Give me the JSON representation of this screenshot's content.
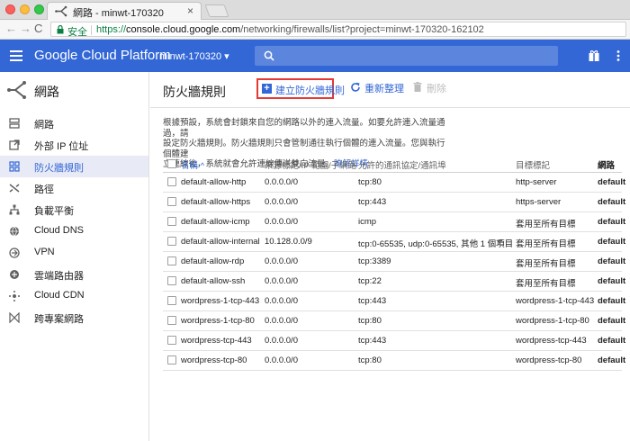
{
  "browser": {
    "tab_title": "網路 - minwt-170320",
    "tab_close": "×",
    "secure_label": "安全",
    "url_scheme": "https://",
    "url_host": "console.cloud.google.com",
    "url_path": "/networking/firewalls/list?project=minwt-170320-162102",
    "nav_back": "←",
    "nav_forward": "→",
    "nav_reload": "C"
  },
  "header": {
    "brand": "Google Cloud Platform",
    "project": "minwt-170320 ▾",
    "accent_color": "#3367d6"
  },
  "sidebar": {
    "title": "網路",
    "items": [
      {
        "label": "網路",
        "icon": "network-icon",
        "active": false
      },
      {
        "label": "外部 IP 位址",
        "icon": "external-ip-icon",
        "active": false
      },
      {
        "label": "防火牆規則",
        "icon": "firewall-icon",
        "active": true
      },
      {
        "label": "路徑",
        "icon": "routes-icon",
        "active": false
      },
      {
        "label": "負載平衡",
        "icon": "load-balancing-icon",
        "active": false
      },
      {
        "label": "Cloud DNS",
        "icon": "dns-icon",
        "active": false
      },
      {
        "label": "VPN",
        "icon": "vpn-icon",
        "active": false
      },
      {
        "label": "雲端路由器",
        "icon": "router-icon",
        "active": false
      },
      {
        "label": "Cloud CDN",
        "icon": "cdn-icon",
        "active": false
      },
      {
        "label": "跨專案網路",
        "icon": "xpn-icon",
        "active": false
      }
    ]
  },
  "page": {
    "title": "防火牆規則",
    "create_label": "建立防火牆規則",
    "refresh_label": "重新整理",
    "delete_label": "刪除",
    "description_1": "根據預設，系統會封鎖來自您的網路以外的連入流量。如要允許連入流量通過，請",
    "description_2": "設定防火牆規則。防火牆規則只會管制通往執行個體的連入流量。您與執行個體建",
    "description_3": "立連線後，系統就會允許連線傳送雙向流量。",
    "learn_more": "瞭解詳情"
  },
  "table": {
    "headers": {
      "name": "名稱 ^",
      "source": "來源標記/IP 範圍/子網路",
      "protocol": "允許的通訊協定/通訊埠",
      "target": "目標標記",
      "network": "網路"
    },
    "rows": [
      {
        "name": "default-allow-http",
        "source": "0.0.0.0/0",
        "protocol": "tcp:80",
        "target": "http-server",
        "network": "default",
        "dropdown": ""
      },
      {
        "name": "default-allow-https",
        "source": "0.0.0.0/0",
        "protocol": "tcp:443",
        "target": "https-server",
        "network": "default",
        "dropdown": ""
      },
      {
        "name": "default-allow-icmp",
        "source": "0.0.0.0/0",
        "protocol": "icmp",
        "target": "套用至所有目標",
        "network": "default",
        "dropdown": ""
      },
      {
        "name": "default-allow-internal",
        "source": "10.128.0.0/9",
        "protocol": "tcp:0-65535, udp:0-65535, 其他 1 個項目",
        "target": "套用至所有目標",
        "network": "default",
        "dropdown": "▼"
      },
      {
        "name": "default-allow-rdp",
        "source": "0.0.0.0/0",
        "protocol": "tcp:3389",
        "target": "套用至所有目標",
        "network": "default",
        "dropdown": ""
      },
      {
        "name": "default-allow-ssh",
        "source": "0.0.0.0/0",
        "protocol": "tcp:22",
        "target": "套用至所有目標",
        "network": "default",
        "dropdown": ""
      },
      {
        "name": "wordpress-1-tcp-443",
        "source": "0.0.0.0/0",
        "protocol": "tcp:443",
        "target": "wordpress-1-tcp-443",
        "network": "default",
        "dropdown": ""
      },
      {
        "name": "wordpress-1-tcp-80",
        "source": "0.0.0.0/0",
        "protocol": "tcp:80",
        "target": "wordpress-1-tcp-80",
        "network": "default",
        "dropdown": ""
      },
      {
        "name": "wordpress-tcp-443",
        "source": "0.0.0.0/0",
        "protocol": "tcp:443",
        "target": "wordpress-tcp-443",
        "network": "default",
        "dropdown": ""
      },
      {
        "name": "wordpress-tcp-80",
        "source": "0.0.0.0/0",
        "protocol": "tcp:80",
        "target": "wordpress-tcp-80",
        "network": "default",
        "dropdown": ""
      }
    ]
  }
}
